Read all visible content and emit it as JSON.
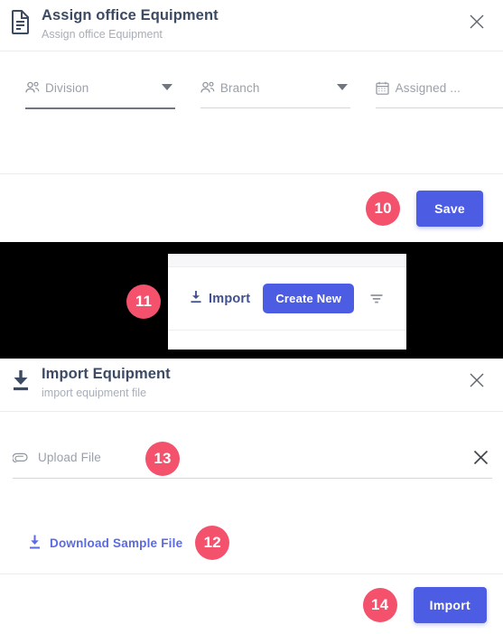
{
  "colors": {
    "accent_blue": "#4c5ce3",
    "badge_pink": "#f4516c",
    "title_slate": "#3c4a63",
    "muted_gray": "#9aa0aa",
    "link_blue": "#5a6ae0",
    "backdrop": "#000000"
  },
  "assign_dialog": {
    "icon": "document-icon",
    "title": "Assign office Equipment",
    "subtitle": "Assign office Equipment",
    "close_icon": "close-icon",
    "fields": [
      {
        "icon": "people-icon",
        "label": "Division",
        "caret": "chevron-down-icon",
        "focused": true
      },
      {
        "icon": "people-icon",
        "label": "Branch",
        "caret": "chevron-down-icon",
        "focused": false
      },
      {
        "icon": "calendar-icon",
        "label": "Assigned ...",
        "caret": "",
        "focused": false
      }
    ],
    "save_label": "Save",
    "save_badge": "10"
  },
  "toolbar": {
    "import_label": "Import",
    "import_icon": "download-icon",
    "create_new_label": "Create New",
    "filter_icon": "filter-icon",
    "badge": "11"
  },
  "import_dialog": {
    "icon": "import-download-icon",
    "title": "Import Equipment",
    "subtitle": "import equipment file",
    "close_icon": "close-icon",
    "upload": {
      "icon": "paperclip-icon",
      "placeholder": "Upload File",
      "value": "",
      "clear_icon": "close-icon",
      "badge": "13"
    },
    "download_sample": {
      "icon": "download-arrow-icon",
      "label": "Download Sample File",
      "badge": "12"
    },
    "import_label": "Import",
    "import_badge": "14"
  }
}
